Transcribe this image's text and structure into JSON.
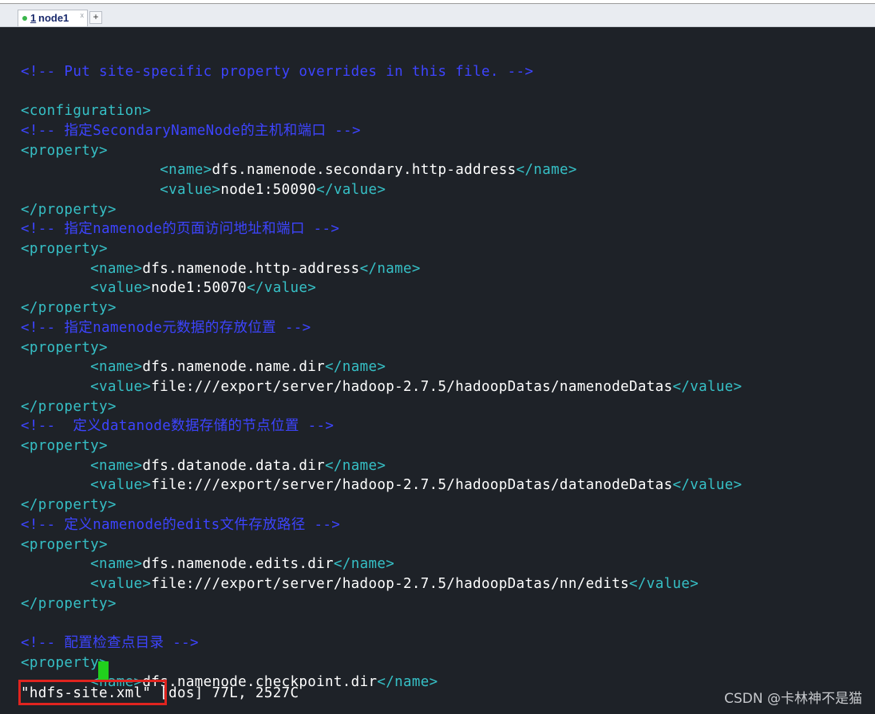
{
  "tab": {
    "number": "1",
    "label": "node1",
    "close_glyph": "x",
    "add_glyph": "+"
  },
  "lines": [
    [],
    [
      {
        "k": "c",
        "t": "<!-- Put site-specific property overrides in this file. -->"
      }
    ],
    [],
    [
      {
        "k": "t",
        "t": "<configuration>"
      }
    ],
    [
      {
        "k": "c",
        "t": "<!-- 指定SecondaryNameNode的主机和端口 -->"
      }
    ],
    [
      {
        "k": "t",
        "t": "<property>"
      }
    ],
    [
      {
        "k": "s",
        "t": "                "
      },
      {
        "k": "t",
        "t": "<name>"
      },
      {
        "k": "v",
        "t": "dfs.namenode.secondary.http-address"
      },
      {
        "k": "t",
        "t": "</name>"
      }
    ],
    [
      {
        "k": "s",
        "t": "                "
      },
      {
        "k": "t",
        "t": "<value>"
      },
      {
        "k": "v",
        "t": "node1:50090"
      },
      {
        "k": "t",
        "t": "</value>"
      }
    ],
    [
      {
        "k": "t",
        "t": "</property>"
      }
    ],
    [
      {
        "k": "c",
        "t": "<!-- 指定namenode的页面访问地址和端口 -->"
      }
    ],
    [
      {
        "k": "t",
        "t": "<property>"
      }
    ],
    [
      {
        "k": "s",
        "t": "        "
      },
      {
        "k": "t",
        "t": "<name>"
      },
      {
        "k": "v",
        "t": "dfs.namenode.http-address"
      },
      {
        "k": "t",
        "t": "</name>"
      }
    ],
    [
      {
        "k": "s",
        "t": "        "
      },
      {
        "k": "t",
        "t": "<value>"
      },
      {
        "k": "v",
        "t": "node1:50070"
      },
      {
        "k": "t",
        "t": "</value>"
      }
    ],
    [
      {
        "k": "t",
        "t": "</property>"
      }
    ],
    [
      {
        "k": "c",
        "t": "<!-- 指定namenode元数据的存放位置 -->"
      }
    ],
    [
      {
        "k": "t",
        "t": "<property>"
      }
    ],
    [
      {
        "k": "s",
        "t": "        "
      },
      {
        "k": "t",
        "t": "<name>"
      },
      {
        "k": "v",
        "t": "dfs.namenode.name.dir"
      },
      {
        "k": "t",
        "t": "</name>"
      }
    ],
    [
      {
        "k": "s",
        "t": "        "
      },
      {
        "k": "t",
        "t": "<value>"
      },
      {
        "k": "v",
        "t": "file:///export/server/hadoop-2.7.5/hadoopDatas/namenodeDatas"
      },
      {
        "k": "t",
        "t": "</value>"
      }
    ],
    [
      {
        "k": "t",
        "t": "</property>"
      }
    ],
    [
      {
        "k": "c",
        "t": "<!--  定义datanode数据存储的节点位置 -->"
      }
    ],
    [
      {
        "k": "t",
        "t": "<property>"
      }
    ],
    [
      {
        "k": "s",
        "t": "        "
      },
      {
        "k": "t",
        "t": "<name>"
      },
      {
        "k": "v",
        "t": "dfs.datanode.data.dir"
      },
      {
        "k": "t",
        "t": "</name>"
      }
    ],
    [
      {
        "k": "s",
        "t": "        "
      },
      {
        "k": "t",
        "t": "<value>"
      },
      {
        "k": "v",
        "t": "file:///export/server/hadoop-2.7.5/hadoopDatas/datanodeDatas"
      },
      {
        "k": "t",
        "t": "</value>"
      }
    ],
    [
      {
        "k": "t",
        "t": "</property>"
      }
    ],
    [
      {
        "k": "c",
        "t": "<!-- 定义namenode的edits文件存放路径 -->"
      }
    ],
    [
      {
        "k": "t",
        "t": "<property>"
      }
    ],
    [
      {
        "k": "s",
        "t": "        "
      },
      {
        "k": "t",
        "t": "<name>"
      },
      {
        "k": "v",
        "t": "dfs.namenode.edits.dir"
      },
      {
        "k": "t",
        "t": "</name>"
      }
    ],
    [
      {
        "k": "s",
        "t": "        "
      },
      {
        "k": "t",
        "t": "<value>"
      },
      {
        "k": "v",
        "t": "file:///export/server/hadoop-2.7.5/hadoopDatas/nn/edits"
      },
      {
        "k": "t",
        "t": "</value>"
      }
    ],
    [
      {
        "k": "t",
        "t": "</property>"
      }
    ],
    [],
    [
      {
        "k": "c",
        "t": "<!-- 配置检查点目录 -->"
      }
    ],
    [
      {
        "k": "t",
        "t": "<property>"
      }
    ],
    [
      {
        "k": "s",
        "t": "        "
      },
      {
        "k": "t",
        "t": "<name>"
      },
      {
        "k": "v",
        "t": "dfs.namenode.checkpoint.dir"
      },
      {
        "k": "t",
        "t": "</name>"
      }
    ]
  ],
  "status": {
    "filename": "\"hdfs-site.xml\"",
    "info": " [dos] 77L, 2527C"
  },
  "watermark": "CSDN @卡林神不是猫",
  "colors": {
    "background": "#1e2228",
    "comment": "#3d44ff",
    "tag": "#36c0c6",
    "value": "#ffffff",
    "cursor": "#21d11d",
    "highlight_box": "#e0241f"
  }
}
